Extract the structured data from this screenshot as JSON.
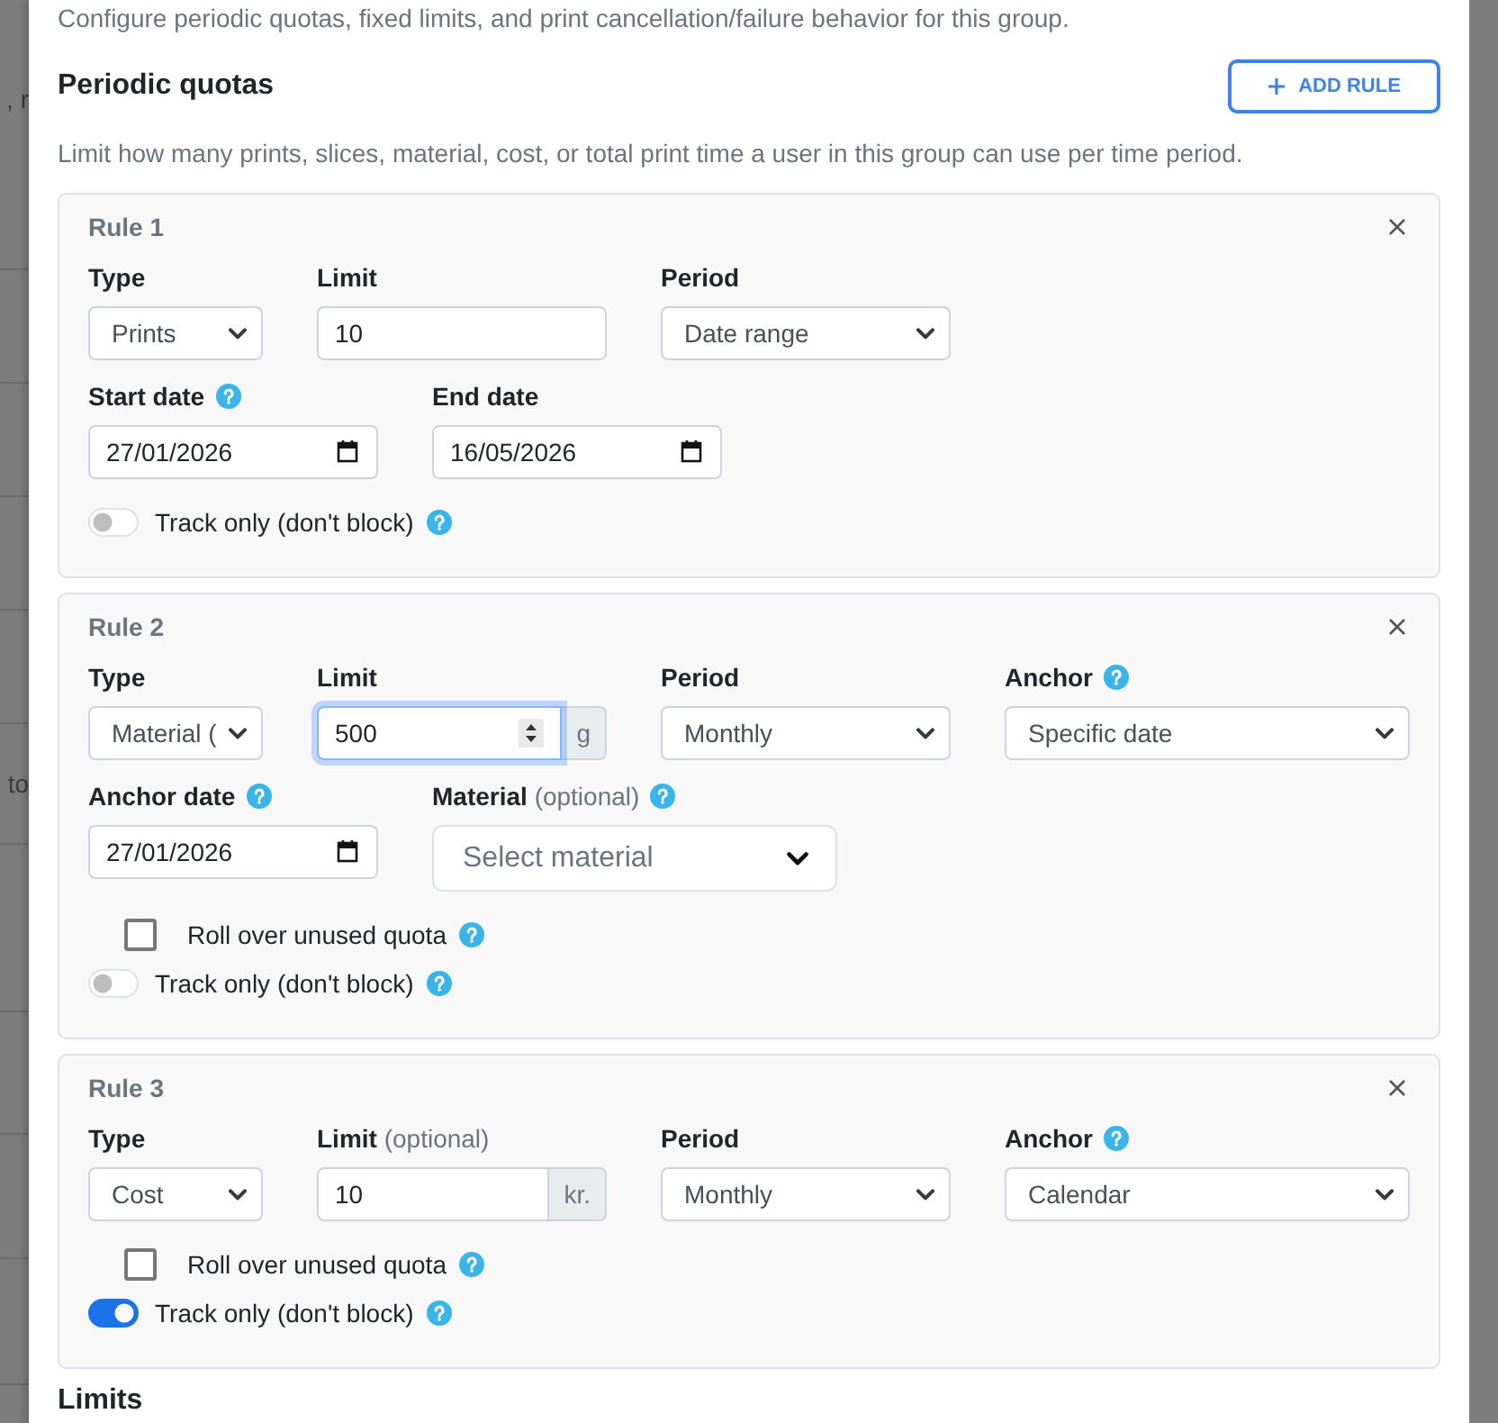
{
  "backdrop": {
    "texts": [
      ", r",
      "to"
    ]
  },
  "intro": "Configure periodic quotas, fixed limits, and print cancellation/failure behavior for this group.",
  "section": {
    "title": "Periodic quotas",
    "add_button": "ADD RULE",
    "description": "Limit how many prints, slices, material, cost, or total print time a user in this group can use per time period."
  },
  "rules": [
    {
      "title": "Rule 1",
      "rows": [
        [
          {
            "kind": "select",
            "label": "Type",
            "help": false,
            "value": "Prints"
          },
          {
            "kind": "number",
            "label": "Limit",
            "help": false,
            "value": "10",
            "focused": false
          },
          {
            "kind": "select",
            "label": "Period",
            "help": false,
            "value": "Date range"
          }
        ],
        [
          {
            "kind": "date",
            "label": "Start date",
            "help": true,
            "value": "27/01/2026"
          },
          {
            "kind": "date",
            "label": "End date",
            "help": false,
            "value": "16/05/2026"
          }
        ]
      ],
      "track_only": {
        "label": "Track only (don't block)",
        "on": false,
        "help": true
      }
    },
    {
      "title": "Rule 2",
      "rows": [
        [
          {
            "kind": "select",
            "label": "Type",
            "help": false,
            "value": "Material ("
          },
          {
            "kind": "number",
            "label": "Limit",
            "help": false,
            "value": "500",
            "unit": "g",
            "focused": true
          },
          {
            "kind": "select",
            "label": "Period",
            "help": false,
            "value": "Monthly"
          },
          {
            "kind": "select",
            "label": "Anchor",
            "help": true,
            "value": "Specific date"
          }
        ],
        [
          {
            "kind": "date",
            "label": "Anchor date",
            "help": true,
            "value": "27/01/2026"
          },
          {
            "kind": "dropdown",
            "label": "Material",
            "note": "(optional)",
            "help": true,
            "placeholder": "Select material"
          }
        ]
      ],
      "rollover": {
        "label": "Roll over unused quota",
        "checked": false,
        "help": true
      },
      "track_only": {
        "label": "Track only (don't block)",
        "on": false,
        "help": true
      }
    },
    {
      "title": "Rule 3",
      "rows": [
        [
          {
            "kind": "select",
            "label": "Type",
            "help": false,
            "value": "Cost"
          },
          {
            "kind": "number",
            "label": "Limit",
            "note": "(optional)",
            "help": false,
            "value": "10",
            "unit": "kr.",
            "focused": false
          },
          {
            "kind": "select",
            "label": "Period",
            "help": false,
            "value": "Monthly"
          },
          {
            "kind": "select",
            "label": "Anchor",
            "help": true,
            "value": "Calendar"
          }
        ]
      ],
      "rollover": {
        "label": "Roll over unused quota",
        "checked": false,
        "help": true
      },
      "track_only": {
        "label": "Track only (don't block)",
        "on": true,
        "help": true
      }
    }
  ],
  "next_section": {
    "title": "Limits"
  }
}
